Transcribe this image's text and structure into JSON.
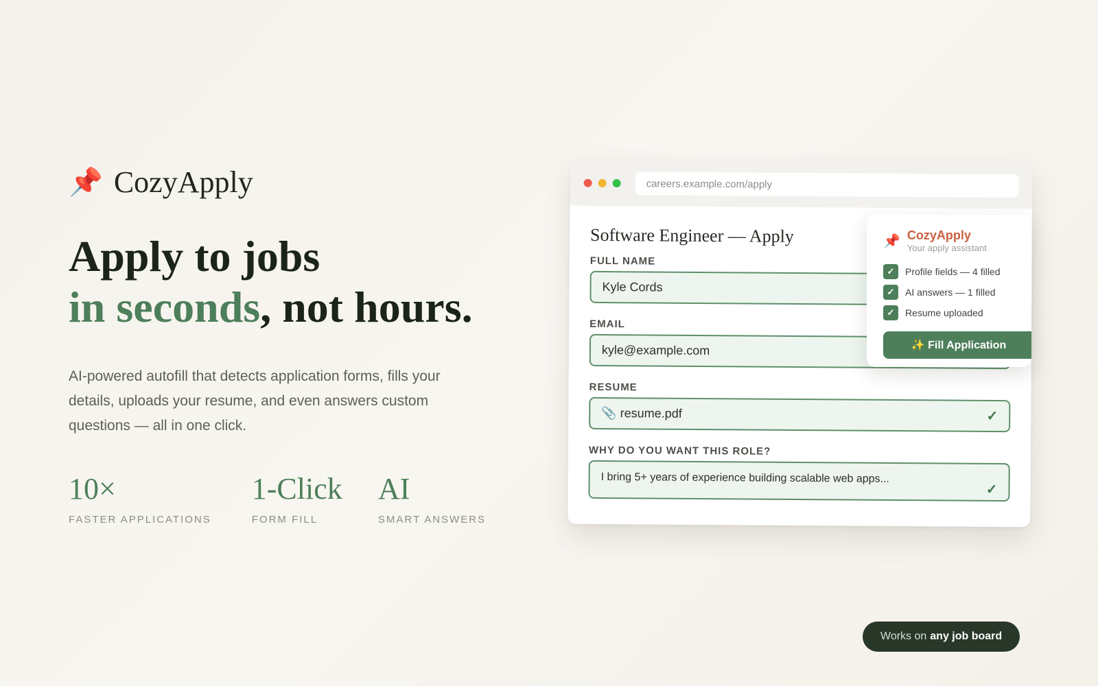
{
  "brand": {
    "icon": "pushpin-icon",
    "emoji": "📌",
    "name": "CozyApply"
  },
  "hero": {
    "line1": "Apply to jobs",
    "line2_accent": "in seconds",
    "line2_rest": ", not hours.",
    "description": "AI-powered autofill that detects application forms, fills your details, uploads your resume, and even answers custom questions — all in one click."
  },
  "stats": [
    {
      "value": "10×",
      "label": "FASTER APPLICATIONS"
    },
    {
      "value": "1-Click",
      "label": "FORM FILL"
    },
    {
      "value": "AI",
      "label": "SMART ANSWERS"
    }
  ],
  "browser": {
    "url": "careers.example.com/apply",
    "form_title": "Software Engineer — Apply",
    "fields": {
      "full_name": {
        "label": "FULL NAME",
        "value": "Kyle Cords"
      },
      "email": {
        "label": "EMAIL",
        "value": "kyle@example.com"
      },
      "resume": {
        "label": "RESUME",
        "icon": "paperclip-icon",
        "value": "📎 resume.pdf",
        "check": "✓"
      },
      "why": {
        "label": "WHY DO YOU WANT THIS ROLE?",
        "value": "I bring 5+ years of experience building scalable web apps...",
        "check": "✓"
      }
    }
  },
  "panel": {
    "pin": "📌",
    "title": "CozyApply",
    "subtitle": "Your apply assistant",
    "check_glyph": "✓",
    "items": [
      "Profile fields — 4 filled",
      "AI answers — 1 filled",
      "Resume uploaded"
    ],
    "button": "✨ Fill Application"
  },
  "badge": {
    "prefix": "Works on",
    "emphasis": "any job board"
  },
  "colors": {
    "accent_green": "#4d7f5a",
    "brand_orange": "#c9623f",
    "badge_bg": "#283728"
  }
}
